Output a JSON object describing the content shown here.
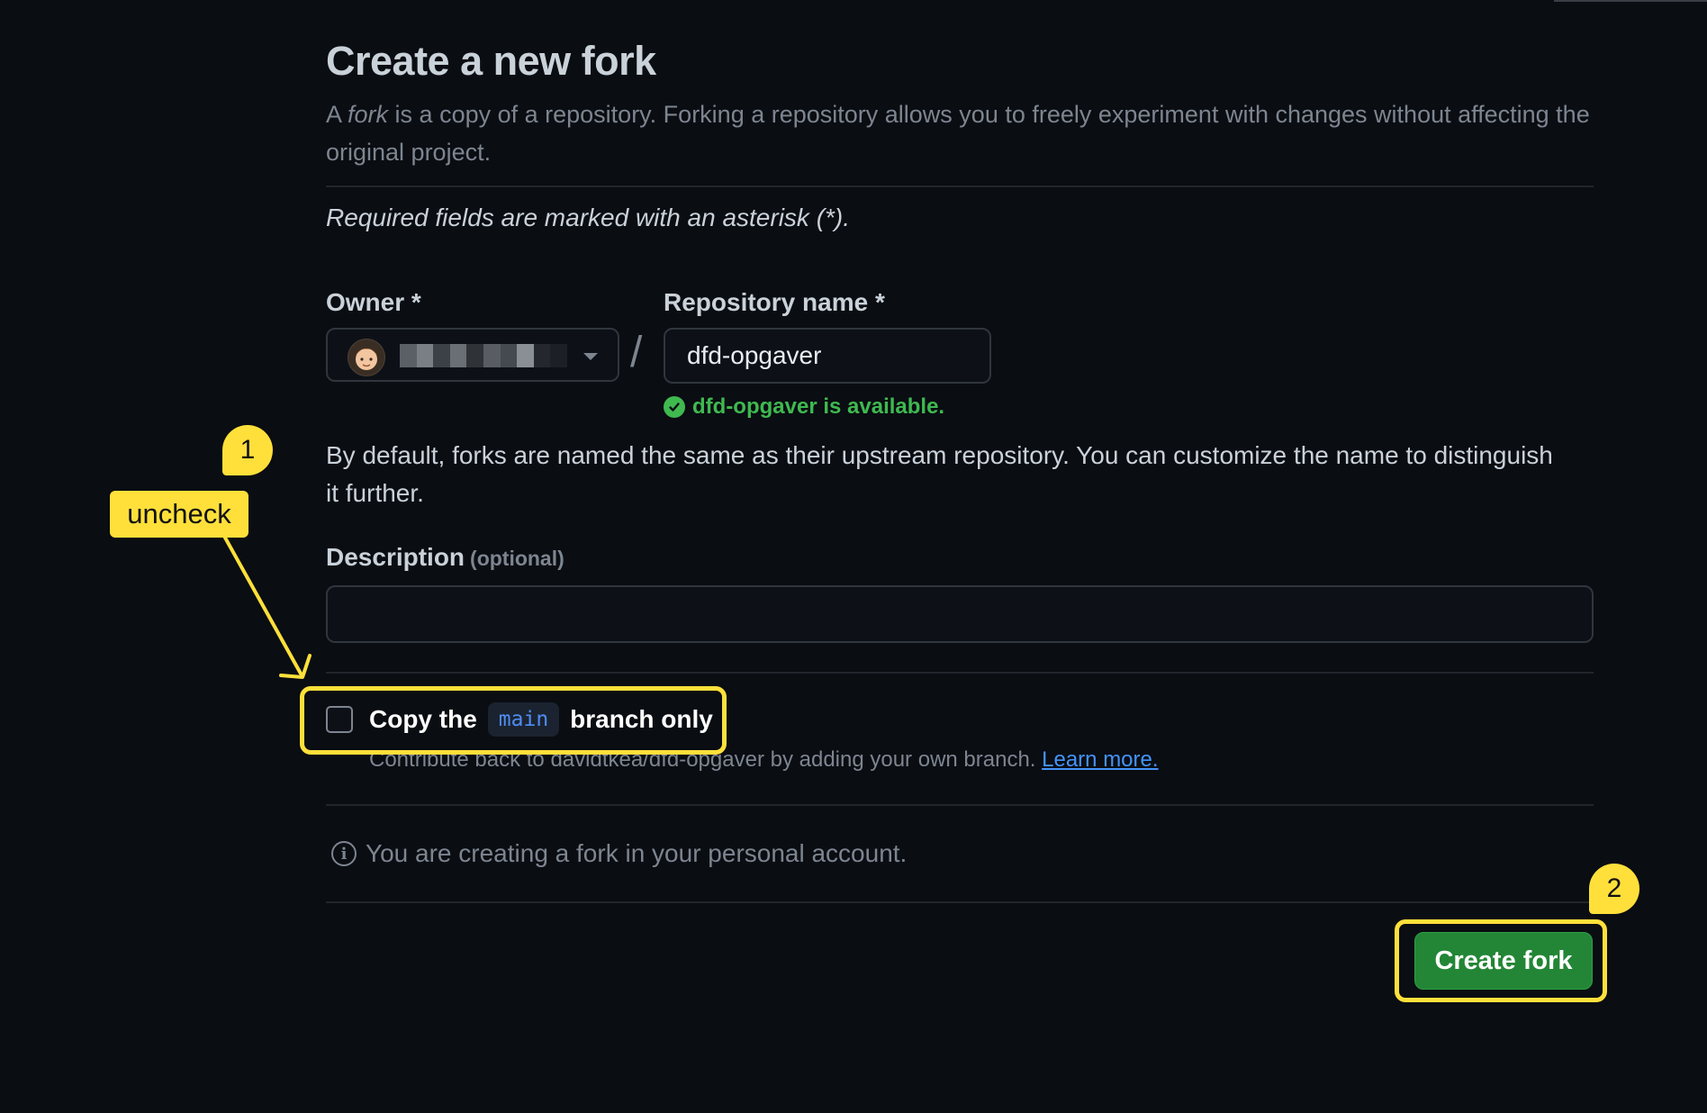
{
  "page": {
    "title": "Create a new fork",
    "subtitle_prefix": "A ",
    "subtitle_em": "fork",
    "subtitle_suffix": " is a copy of a repository. Forking a repository allows you to freely experiment with changes without affecting the original project.",
    "required_note": "Required fields are marked with an asterisk (*)."
  },
  "form": {
    "owner_label": "Owner *",
    "repo_label": "Repository name *",
    "separator": "/",
    "repo_value": "dfd-opgaver",
    "availability": "dfd-opgaver is available.",
    "naming_info": "By default, forks are named the same as their upstream repository. You can customize the name to distinguish it further.",
    "description_label": "Description",
    "description_optional": "(optional)",
    "description_value": "",
    "copy_prefix": "Copy the",
    "copy_branch": "main",
    "copy_suffix": "branch only",
    "copy_checked": false,
    "contrib_text": "Contribute back to davidtkea/dfd-opgaver by adding your own branch.",
    "learn_more": "Learn more.",
    "personal_note": "You are creating a fork in your personal account.",
    "create_button": "Create fork"
  },
  "annotations": {
    "step1_number": "1",
    "step1_label": "uncheck",
    "step2_number": "2",
    "color": "#ffe03a"
  },
  "colors": {
    "background": "#0a0d12",
    "success": "#3fb950",
    "primary_button": "#238636",
    "link": "#4493f8"
  },
  "icons": {
    "caret": "chevron-down-icon",
    "available": "check-circle-icon",
    "info": "info-icon"
  }
}
